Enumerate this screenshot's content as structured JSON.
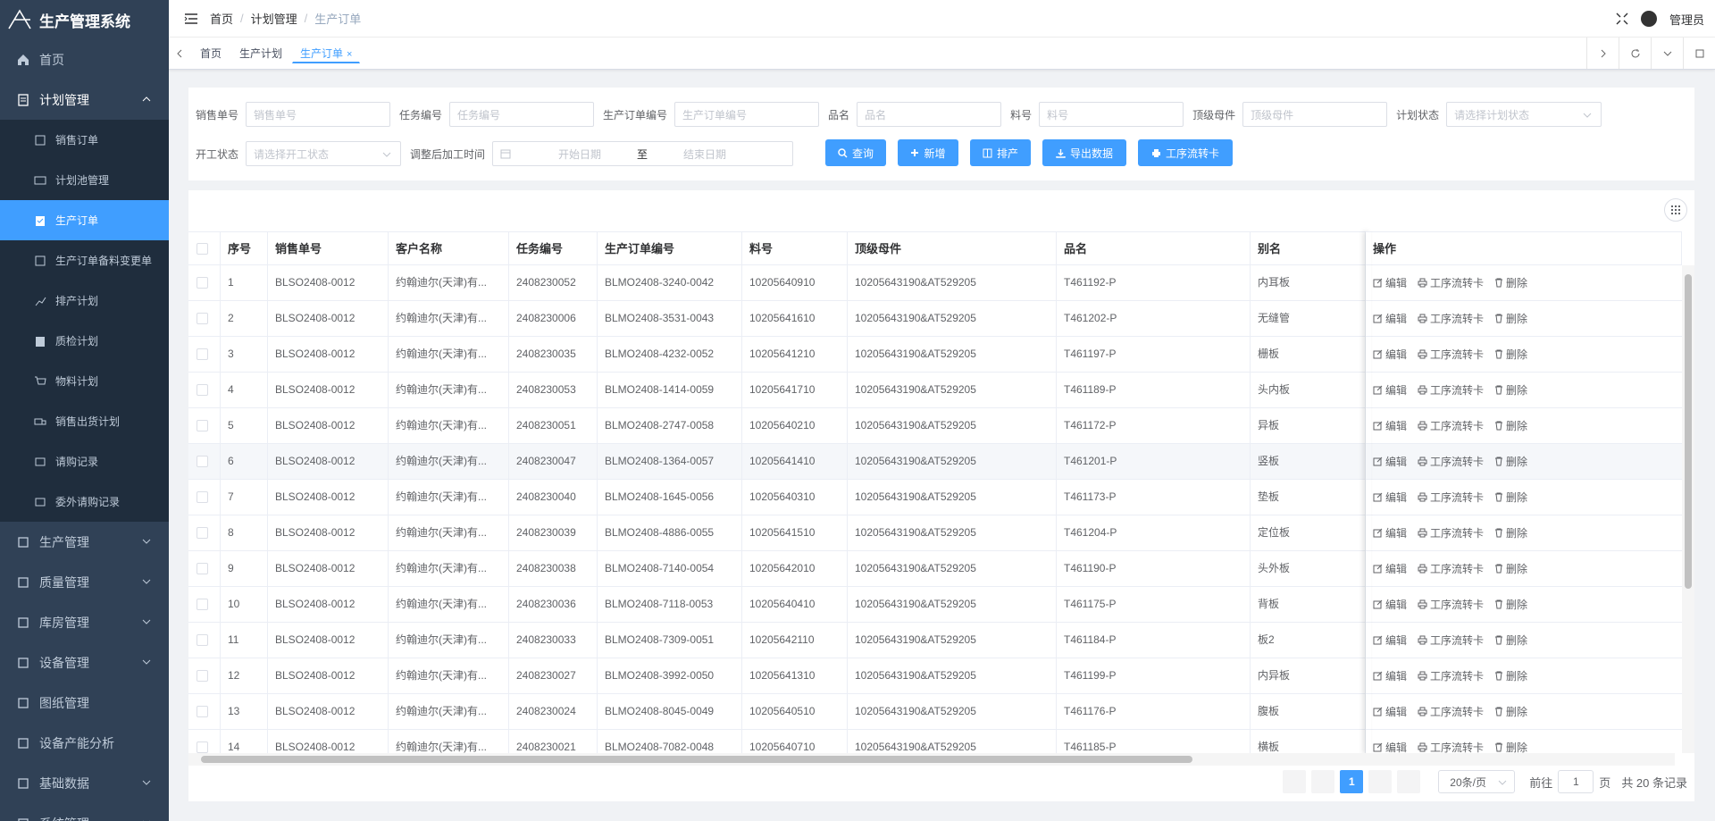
{
  "app": {
    "title": "生产管理系统"
  },
  "sidebar": {
    "home": "首页",
    "plan": "计划管理",
    "plan_items": [
      "销售订单",
      "计划池管理",
      "生产订单",
      "生产订单备料变更单",
      "排产计划",
      "质检计划",
      "物料计划",
      "销售出货计划",
      "请购记录",
      "委外请购记录"
    ],
    "groups": [
      "生产管理",
      "质量管理",
      "库房管理",
      "设备管理",
      "图纸管理",
      "设备产能分析",
      "基础数据",
      "系统管理"
    ]
  },
  "navbar": {
    "crumbs": [
      "首页",
      "计划管理",
      "生产订单"
    ],
    "sep": "/",
    "user": "管理员"
  },
  "tags": [
    "首页",
    "生产计划",
    "生产订单"
  ],
  "tag_close": "×",
  "filters": {
    "sales_no": {
      "label": "销售单号",
      "placeholder": "销售单号"
    },
    "task_no": {
      "label": "任务编号",
      "placeholder": "任务编号"
    },
    "order_no": {
      "label": "生产订单编号",
      "placeholder": "生产订单编号"
    },
    "name": {
      "label": "品名",
      "placeholder": "品名"
    },
    "material": {
      "label": "料号",
      "placeholder": "料号"
    },
    "top_parent": {
      "label": "顶级母件",
      "placeholder": "顶级母件"
    },
    "plan_status": {
      "label": "计划状态",
      "placeholder": "请选择计划状态"
    },
    "start_status": {
      "label": "开工状态",
      "placeholder": "请选择开工状态"
    },
    "adjust_time": {
      "label": "调整后加工时间",
      "start": "开始日期",
      "to": "至",
      "end": "结束日期"
    }
  },
  "buttons": {
    "query": "查询",
    "add": "新增",
    "schedule": "排产",
    "export": "导出数据",
    "flowcard": "工序流转卡"
  },
  "table": {
    "headers": [
      "序号",
      "销售单号",
      "客户名称",
      "任务编号",
      "生产订单编号",
      "料号",
      "顶级母件",
      "品名",
      "别名",
      "操作"
    ],
    "ops": [
      "编辑",
      "工序流转卡",
      "删除"
    ],
    "rows": [
      [
        "1",
        "BLSO2408-0012",
        "约翰迪尔(天津)有...",
        "2408230052",
        "BLMO2408-3240-0042",
        "10205640910",
        "10205643190&AT529205",
        "T461192-P",
        "内耳板"
      ],
      [
        "2",
        "BLSO2408-0012",
        "约翰迪尔(天津)有...",
        "2408230006",
        "BLMO2408-3531-0043",
        "10205641610",
        "10205643190&AT529205",
        "T461202-P",
        "无缝管"
      ],
      [
        "3",
        "BLSO2408-0012",
        "约翰迪尔(天津)有...",
        "2408230035",
        "BLMO2408-4232-0052",
        "10205641210",
        "10205643190&AT529205",
        "T461197-P",
        "栅板"
      ],
      [
        "4",
        "BLSO2408-0012",
        "约翰迪尔(天津)有...",
        "2408230053",
        "BLMO2408-1414-0059",
        "10205641710",
        "10205643190&AT529205",
        "T461189-P",
        "头内板"
      ],
      [
        "5",
        "BLSO2408-0012",
        "约翰迪尔(天津)有...",
        "2408230051",
        "BLMO2408-2747-0058",
        "10205640210",
        "10205643190&AT529205",
        "T461172-P",
        "异板"
      ],
      [
        "6",
        "BLSO2408-0012",
        "约翰迪尔(天津)有...",
        "2408230047",
        "BLMO2408-1364-0057",
        "10205641410",
        "10205643190&AT529205",
        "T461201-P",
        "竖板"
      ],
      [
        "7",
        "BLSO2408-0012",
        "约翰迪尔(天津)有...",
        "2408230040",
        "BLMO2408-1645-0056",
        "10205640310",
        "10205643190&AT529205",
        "T461173-P",
        "垫板"
      ],
      [
        "8",
        "BLSO2408-0012",
        "约翰迪尔(天津)有...",
        "2408230039",
        "BLMO2408-4886-0055",
        "10205641510",
        "10205643190&AT529205",
        "T461204-P",
        "定位板"
      ],
      [
        "9",
        "BLSO2408-0012",
        "约翰迪尔(天津)有...",
        "2408230038",
        "BLMO2408-7140-0054",
        "10205642010",
        "10205643190&AT529205",
        "T461190-P",
        "头外板"
      ],
      [
        "10",
        "BLSO2408-0012",
        "约翰迪尔(天津)有...",
        "2408230036",
        "BLMO2408-7118-0053",
        "10205640410",
        "10205643190&AT529205",
        "T461175-P",
        "背板"
      ],
      [
        "11",
        "BLSO2408-0012",
        "约翰迪尔(天津)有...",
        "2408230033",
        "BLMO2408-7309-0051",
        "10205642110",
        "10205643190&AT529205",
        "T461184-P",
        "板2"
      ],
      [
        "12",
        "BLSO2408-0012",
        "约翰迪尔(天津)有...",
        "2408230027",
        "BLMO2408-3992-0050",
        "10205641310",
        "10205643190&AT529205",
        "T461199-P",
        "内异板"
      ],
      [
        "13",
        "BLSO2408-0012",
        "约翰迪尔(天津)有...",
        "2408230024",
        "BLMO2408-8045-0049",
        "10205640510",
        "10205643190&AT529205",
        "T461176-P",
        "腹板"
      ],
      [
        "14",
        "BLSO2408-0012",
        "约翰迪尔(天津)有...",
        "2408230021",
        "BLMO2408-7082-0048",
        "10205640710",
        "10205643190&AT529205",
        "T461185-P",
        "横板"
      ]
    ]
  },
  "pager": {
    "current": "1",
    "size": "20条/页",
    "goto": "前往",
    "page_unit": "页",
    "goto_value": "1",
    "total": "共 20 条记录"
  }
}
